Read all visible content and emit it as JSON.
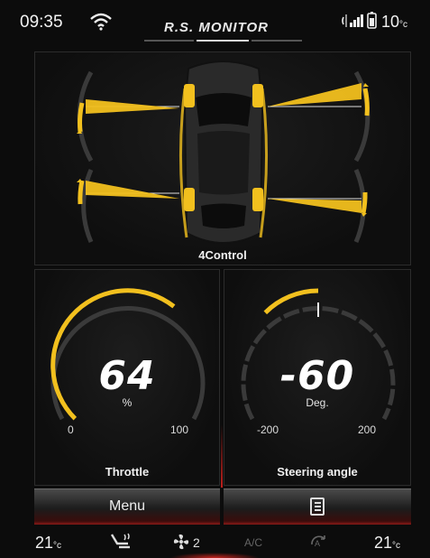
{
  "status": {
    "time": "09:35",
    "title": "R.S. MONITOR",
    "temperature": "10",
    "temperature_unit": "°c"
  },
  "fourcontrol": {
    "label": "4Control"
  },
  "throttle": {
    "value": "64",
    "unit": "%",
    "min": "0",
    "max": "100",
    "label": "Throttle",
    "fraction": 0.64
  },
  "steering": {
    "value": "-60",
    "unit": "Deg.",
    "min": "-200",
    "max": "200",
    "label": "Steering angle",
    "fraction": 0.35
  },
  "menu": {
    "menu_label": "Menu"
  },
  "climate": {
    "left_temp": "21",
    "right_temp": "21",
    "temp_unit": "°c",
    "fan_level": "2",
    "ac_label": "A/C"
  },
  "colors": {
    "accent_yellow": "#f2c01e",
    "track_gray": "#3a3a3a",
    "brand_red": "#c0201c"
  },
  "icons": [
    "wifi-icon",
    "bluetooth-icon",
    "signal-icon",
    "battery-icon",
    "list-icon",
    "seat-heater-icon",
    "fan-icon",
    "auto-climate-icon"
  ]
}
